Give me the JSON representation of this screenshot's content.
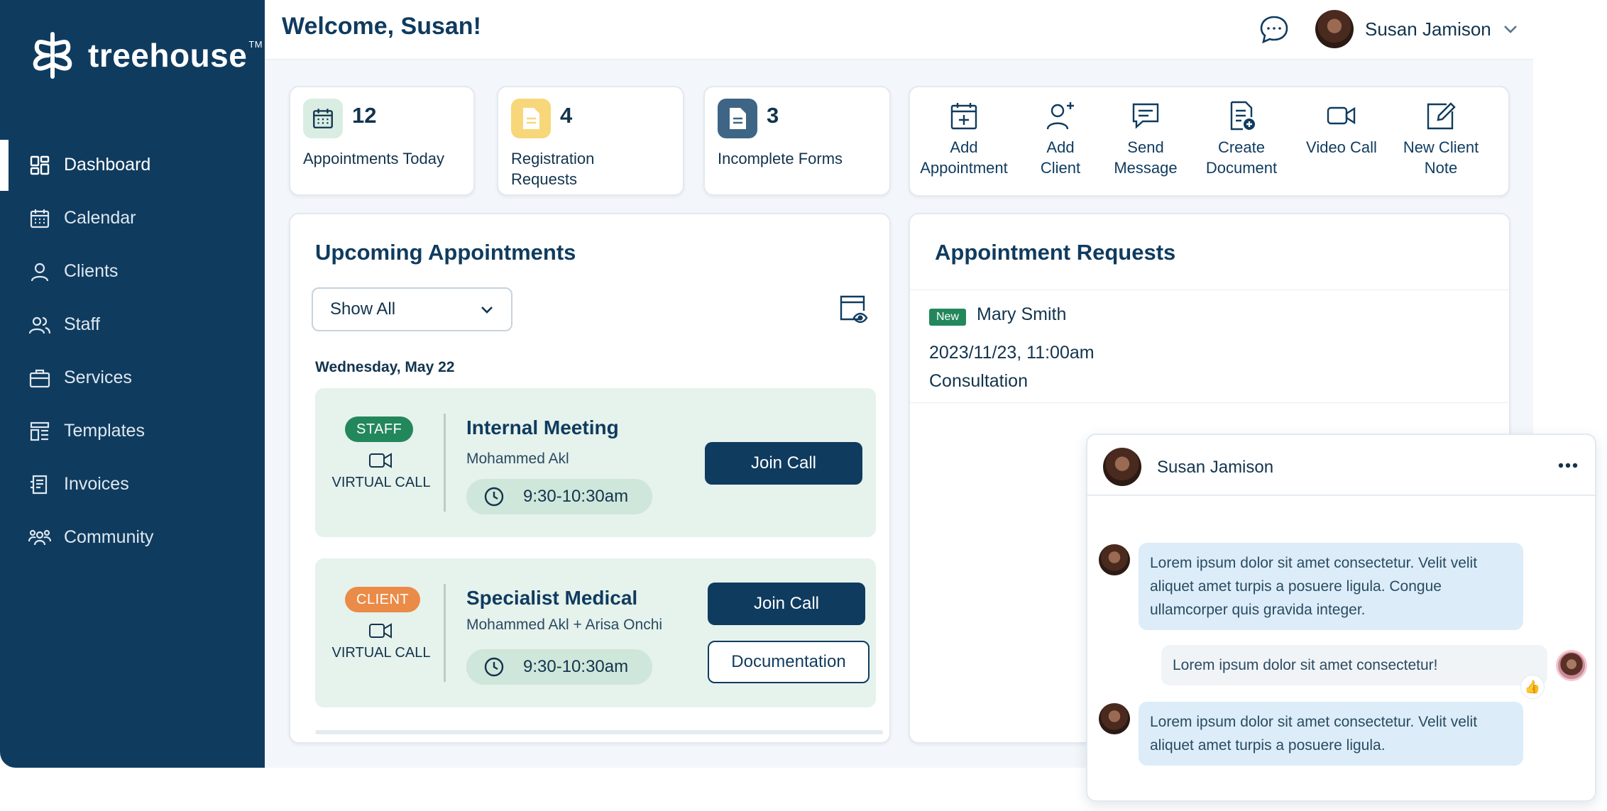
{
  "brand": {
    "name": "treehouse",
    "trademark": "TM"
  },
  "sidebar": {
    "items": [
      {
        "label": "Dashboard",
        "icon": "dashboard-icon",
        "active": true
      },
      {
        "label": "Calendar",
        "icon": "calendar-icon"
      },
      {
        "label": "Clients",
        "icon": "person-icon"
      },
      {
        "label": "Staff",
        "icon": "people-icon"
      },
      {
        "label": "Services",
        "icon": "briefcase-icon"
      },
      {
        "label": "Templates",
        "icon": "template-icon"
      },
      {
        "label": "Invoices",
        "icon": "invoice-icon"
      },
      {
        "label": "Community",
        "icon": "community-icon"
      }
    ]
  },
  "header": {
    "welcome": "Welcome, Susan!",
    "user_name": "Susan Jamison"
  },
  "stats": [
    {
      "count": "12",
      "label": "Appointments Today",
      "icon": "calendar-icon",
      "color": "#d9ede3"
    },
    {
      "count": "4",
      "label": "Registration Requests",
      "icon": "document-icon",
      "color": "#f8d77a"
    },
    {
      "count": "3",
      "label": "Incomplete Forms",
      "icon": "document-icon",
      "color": "#3e6585"
    }
  ],
  "quick_actions": [
    {
      "label": "Add Appointment",
      "icon": "calendar-plus-icon"
    },
    {
      "label": "Add Client",
      "icon": "person-plus-icon"
    },
    {
      "label": "Send Message",
      "icon": "message-icon"
    },
    {
      "label": "Create Document",
      "icon": "document-plus-icon"
    },
    {
      "label": "Video Call",
      "icon": "video-icon"
    },
    {
      "label": "New Client Note",
      "icon": "edit-note-icon"
    }
  ],
  "upcoming": {
    "title": "Upcoming Appointments",
    "filter": "Show All",
    "day_label": "Wednesday, May 22",
    "appointments": [
      {
        "type": "STAFF",
        "mode": "VIRTUAL CALL",
        "title": "Internal Meeting",
        "people": "Mohammed Akl",
        "time": "9:30-10:30am",
        "primary_action": "Join Call"
      },
      {
        "type": "CLIENT",
        "mode": "VIRTUAL CALL",
        "title": "Specialist Medical",
        "people": "Mohammed Akl + Arisa Onchi",
        "time": "9:30-10:30am",
        "primary_action": "Join Call",
        "secondary_action": "Documentation"
      }
    ]
  },
  "requests": {
    "title": "Appointment Requests",
    "items": [
      {
        "tag": "New",
        "name": "Mary Smith",
        "datetime": "2023/11/23, 11:00am",
        "type": "Consultation"
      }
    ]
  },
  "chat": {
    "name": "Susan Jamison",
    "messages": [
      {
        "direction": "in",
        "text": "Lorem ipsum dolor sit amet consectetur. Velit velit aliquet amet turpis a posuere ligula. Congue ullamcorper quis gravida integer."
      },
      {
        "direction": "out",
        "text": "Lorem ipsum dolor sit amet consectetur!",
        "reaction": "thumbs-up"
      },
      {
        "direction": "in",
        "text": "Lorem ipsum dolor sit amet consectetur. Velit velit aliquet amet turpis a posuere ligula."
      }
    ]
  },
  "colors": {
    "navy": "#0f3b5f",
    "staff_green": "#23875c",
    "client_orange": "#ea8b47",
    "appointment_bg": "#e6f2ec",
    "bubble_in": "#dcedf9"
  }
}
